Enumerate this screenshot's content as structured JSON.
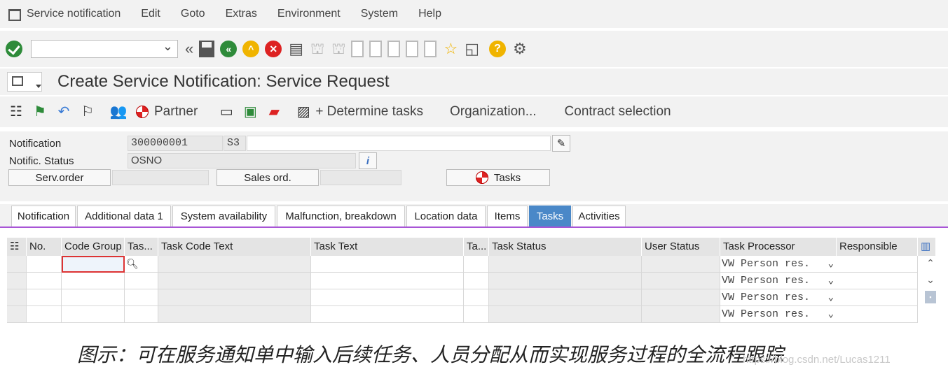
{
  "menu": [
    "Service notification",
    "Edit",
    "Goto",
    "Extras",
    "Environment",
    "System",
    "Help"
  ],
  "title": "Create Service Notification: Service Request",
  "app_toolbar": {
    "partner": "Partner",
    "determine_tasks": "+ Determine tasks",
    "organization": "Organization...",
    "contract_selection": "Contract selection"
  },
  "header": {
    "notification_label": "Notification",
    "notification_value": "300000001",
    "notification_type": "S3",
    "status_label": "Notific. Status",
    "status_value": "OSNO",
    "serv_order_button": "Serv.order",
    "sales_ord_button": "Sales ord.",
    "tasks_button": "Tasks"
  },
  "tabs": [
    "Notification",
    "Additional data 1",
    "System availability",
    "Malfunction, breakdown",
    "Location data",
    "Items",
    "Tasks",
    "Activities"
  ],
  "active_tab": "Tasks",
  "table": {
    "columns": [
      "No.",
      "Code Group",
      "Tas...",
      "Task Code Text",
      "Task Text",
      "Ta...",
      "Task Status",
      "User Status",
      "Task Processor",
      "Responsible"
    ],
    "processor_value": "VW Person res."
  },
  "caption": "图示：可在服务通知单中输入后续任务、人员分配从而实现服务过程的全流程跟踪",
  "watermark": "https://blog.csdn.net/Lucas1211"
}
